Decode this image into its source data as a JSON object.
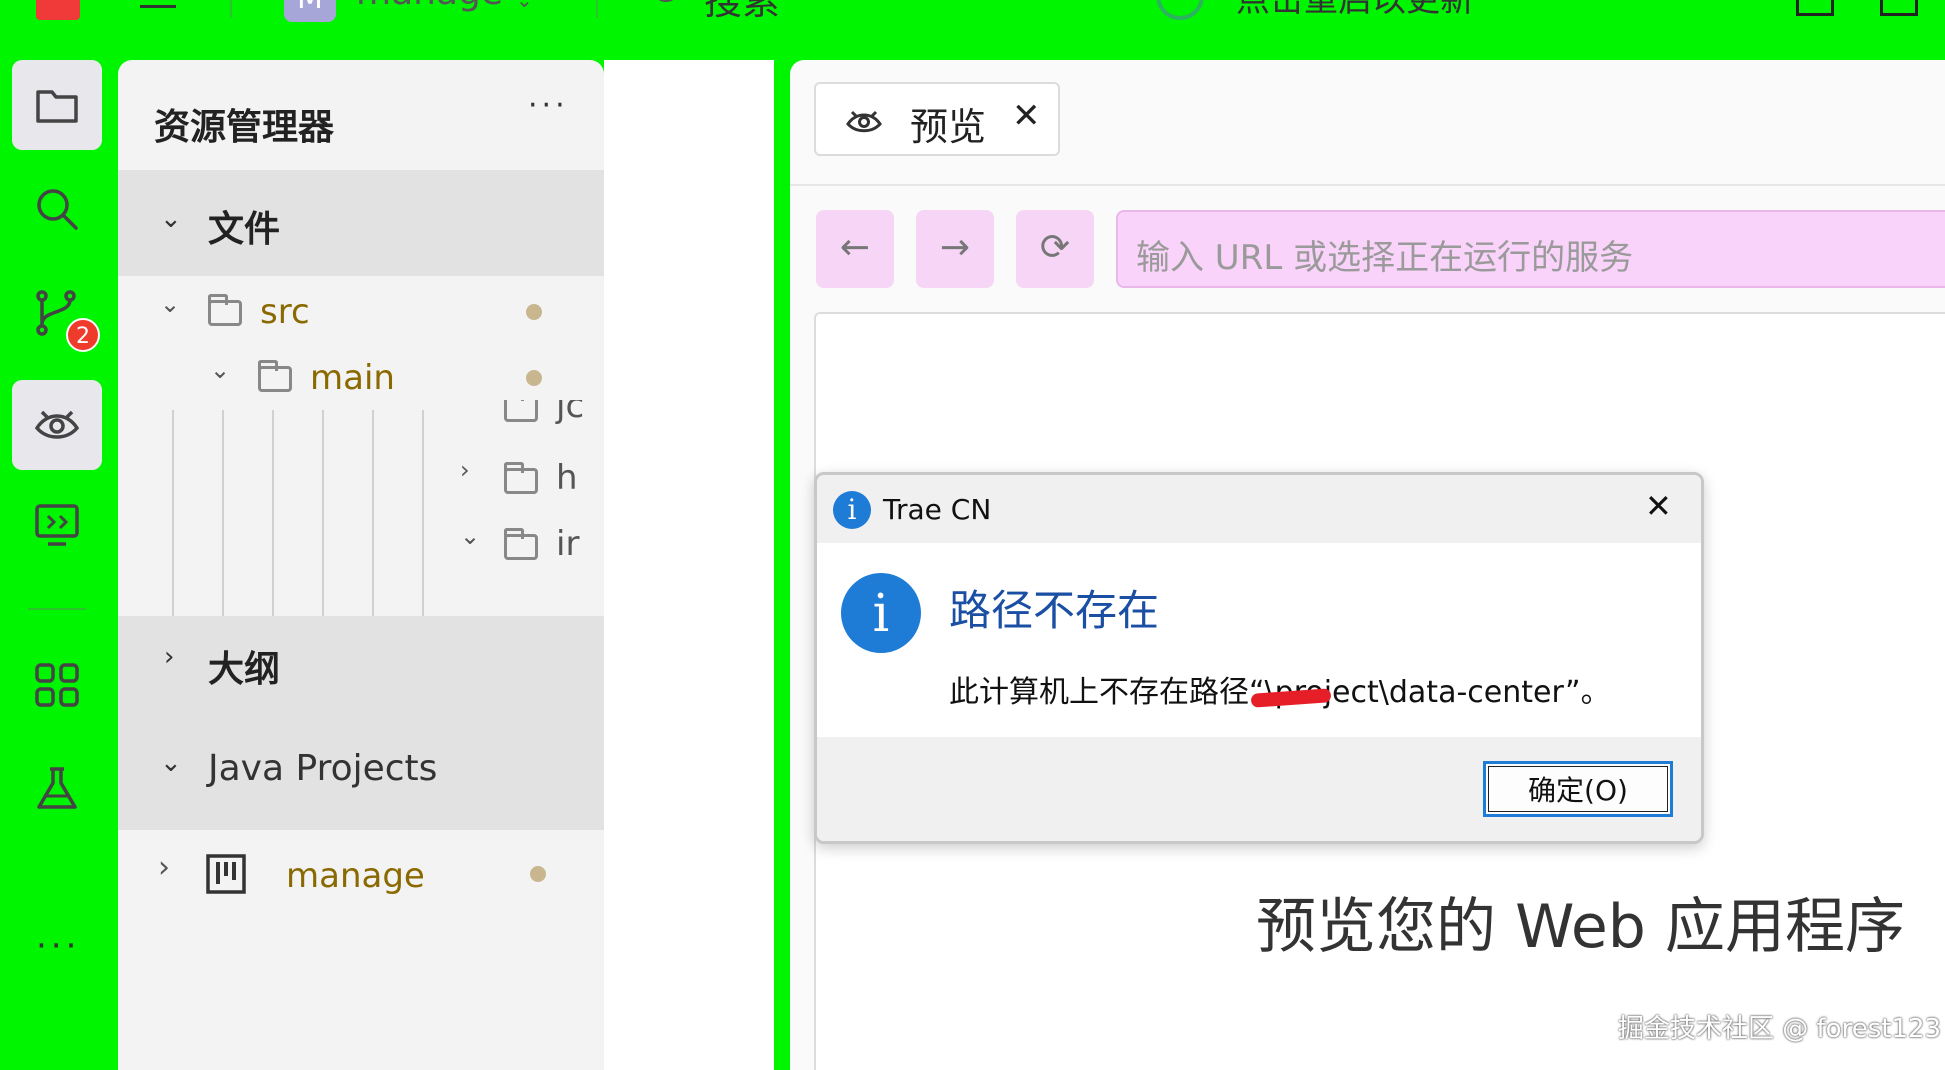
{
  "topbar": {
    "project_badge": "M",
    "project_name": "manage",
    "search_label": "搜索",
    "update_label": "点击重启以更新"
  },
  "activity": {
    "scm_badge": "2"
  },
  "explorer": {
    "title": "资源管理器",
    "more": "···",
    "sections": {
      "files": "文件",
      "outline": "大纲",
      "java_projects": "Java Projects"
    },
    "tree": {
      "src": "src",
      "main": "main",
      "child1": "jc",
      "child2": "h",
      "child3": "ir"
    },
    "java_project": "manage"
  },
  "preview": {
    "tab_label": "预览",
    "url_placeholder": "输入 URL 或选择正在运行的服务",
    "big_text": "预览您的 Web 应用程序"
  },
  "dialog": {
    "title": "Trae CN",
    "heading": "路径不存在",
    "message": "此计算机上不存在路径“\\project\\data-center”。",
    "ok_label": "确定(O)"
  },
  "watermark": "掘金技术社区 @ forest123",
  "colors": {
    "background_green": "#00f500",
    "accent_blue": "#1e7bd6",
    "badge_red": "#ef3b2b",
    "url_bar_pink": "#f9d3f9",
    "tree_label_gold": "#8a6a00"
  }
}
